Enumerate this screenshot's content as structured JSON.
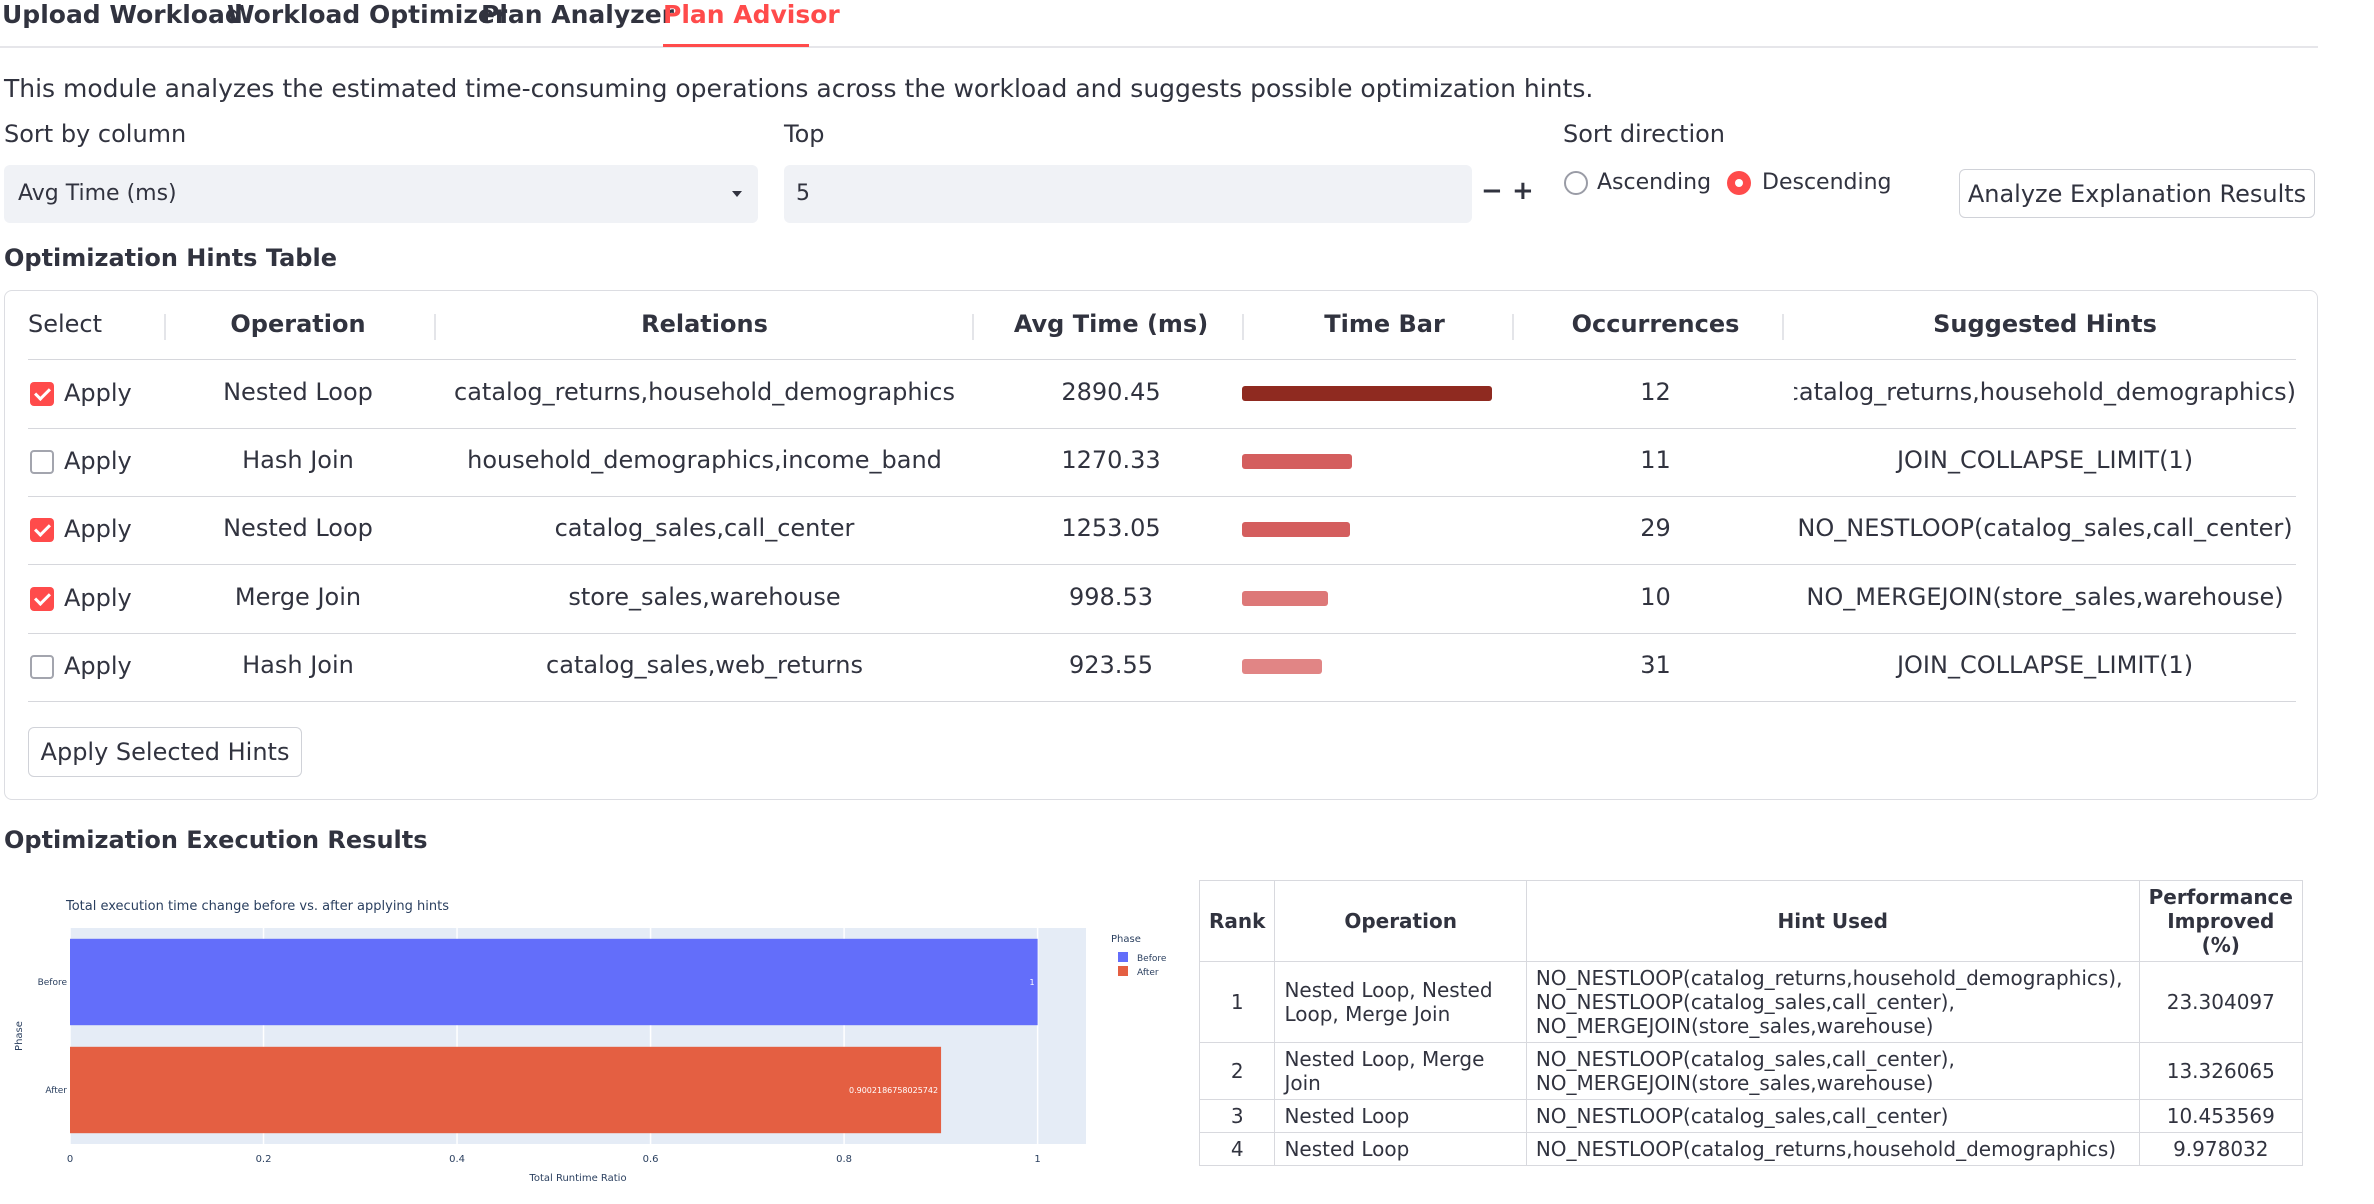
{
  "tabs": [
    {
      "label": "Upload Workload",
      "active": false
    },
    {
      "label": "Workload Optimizer",
      "active": false
    },
    {
      "label": "Plan Analyzer",
      "active": false
    },
    {
      "label": "Plan Advisor",
      "active": true
    }
  ],
  "intro": "This module analyzes the estimated time-consuming operations across the workload and suggests possible optimization hints.",
  "controls": {
    "sort_by_label": "Sort by column",
    "sort_by_value": "Avg Time (ms)",
    "top_label": "Top",
    "top_value": "5",
    "decrement": "−",
    "increment": "+",
    "sort_direction_label": "Sort direction",
    "ascending_label": "Ascending",
    "descending_label": "Descending",
    "sort_direction_selected": "Descending",
    "analyze_button": "Analyze Explanation Results"
  },
  "hints_table": {
    "title": "Optimization Hints Table",
    "headers": [
      "Select",
      "Operation",
      "Relations",
      "Avg Time (ms)",
      "Time Bar",
      "Occurrences",
      "Suggested Hints"
    ],
    "rows": [
      {
        "checked": true,
        "select": "Apply",
        "operation": "Nested Loop",
        "relations": "catalog_returns,household_demographics",
        "avg_time": "2890.45",
        "occurrences": "12",
        "hint": "NO_NESTLOOP(catalog_returns,household_demographics)",
        "bar_color": "#8f2a20"
      },
      {
        "checked": false,
        "select": "Apply",
        "operation": "Hash Join",
        "relations": "household_demographics,income_band",
        "avg_time": "1270.33",
        "occurrences": "11",
        "hint": "JOIN_COLLAPSE_LIMIT(1)",
        "bar_color": "#d45e5e"
      },
      {
        "checked": true,
        "select": "Apply",
        "operation": "Nested Loop",
        "relations": "catalog_sales,call_center",
        "avg_time": "1253.05",
        "occurrences": "29",
        "hint": "NO_NESTLOOP(catalog_sales,call_center)",
        "bar_color": "#d45e5e"
      },
      {
        "checked": true,
        "select": "Apply",
        "operation": "Merge Join",
        "relations": "store_sales,warehouse",
        "avg_time": "998.53",
        "occurrences": "10",
        "hint": "NO_MERGEJOIN(store_sales,warehouse)",
        "bar_color": "#dd7878"
      },
      {
        "checked": false,
        "select": "Apply",
        "operation": "Hash Join",
        "relations": "catalog_sales,web_returns",
        "avg_time": "923.55",
        "occurrences": "31",
        "hint": "JOIN_COLLAPSE_LIMIT(1)",
        "bar_color": "#e18585"
      }
    ],
    "apply_button": "Apply Selected Hints"
  },
  "results": {
    "title": "Optimization Execution Results",
    "headers": [
      "Rank",
      "Operation",
      "Hint Used",
      "Performance Improved (%)"
    ],
    "rows": [
      {
        "rank": "1",
        "operation": "Nested Loop, Nested Loop, Merge Join",
        "hint": [
          "NO_NESTLOOP(catalog_returns,household_demographics),",
          "NO_NESTLOOP(catalog_sales,call_center),",
          "NO_MERGEJOIN(store_sales,warehouse)"
        ],
        "perf": "23.304097"
      },
      {
        "rank": "2",
        "operation": "Nested Loop, Merge Join",
        "hint": [
          "NO_NESTLOOP(catalog_sales,call_center),",
          "NO_MERGEJOIN(store_sales,warehouse)"
        ],
        "perf": "13.326065"
      },
      {
        "rank": "3",
        "operation": "Nested Loop",
        "hint": [
          "NO_NESTLOOP(catalog_sales,call_center)"
        ],
        "perf": "10.453569"
      },
      {
        "rank": "4",
        "operation": "Nested Loop",
        "hint": [
          "NO_NESTLOOP(catalog_returns,household_demographics)"
        ],
        "perf": "9.978032"
      }
    ]
  },
  "chart_data": {
    "type": "bar",
    "orientation": "horizontal",
    "title": "Total execution time change before vs. after applying hints",
    "xlabel": "Total Runtime Ratio",
    "ylabel": "Phase",
    "categories": [
      "Before",
      "After"
    ],
    "values": [
      1,
      0.9002186758025742
    ],
    "value_labels": [
      "1",
      "0.9002186758025742"
    ],
    "xlim": [
      0,
      1.05
    ],
    "xticks": [
      "0",
      "0.2",
      "0.4",
      "0.6",
      "0.8",
      "1"
    ],
    "legend_title": "Phase",
    "legend_position": "right",
    "series": [
      {
        "name": "Before",
        "color": "#636efa"
      },
      {
        "name": "After",
        "color": "#e45f42"
      }
    ]
  }
}
